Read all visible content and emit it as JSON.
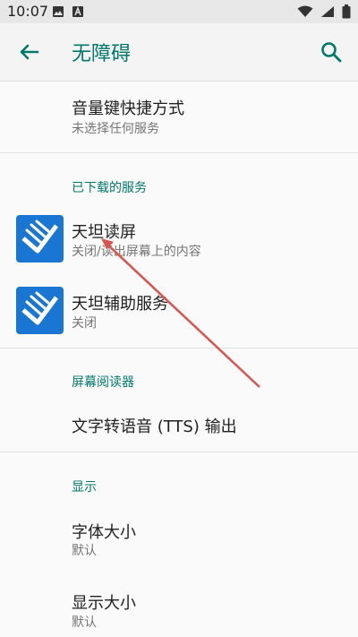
{
  "status_bar": {
    "time": "10:07"
  },
  "app_bar": {
    "title": "无障碍"
  },
  "items": {
    "volume_shortcut": {
      "title": "音量键快捷方式",
      "summary": "未选择任何服务"
    },
    "tiantan_reader": {
      "title": "天坦读屏",
      "summary": "关闭/读出屏幕上的内容"
    },
    "tiantan_assist": {
      "title": "天坦辅助服务",
      "summary": "关闭"
    },
    "tts_output": {
      "title": "文字转语音 (TTS) 输出"
    },
    "font_size": {
      "title": "字体大小",
      "summary": "默认"
    },
    "display_size": {
      "title": "显示大小",
      "summary": "默认"
    }
  },
  "sections": {
    "downloaded": "已下载的服务",
    "screen_reader": "屏幕阅读器",
    "display": "显示"
  },
  "colors": {
    "accent": "#00796b",
    "icon_blue": "#1976d2",
    "arrow": "#d9534f"
  }
}
